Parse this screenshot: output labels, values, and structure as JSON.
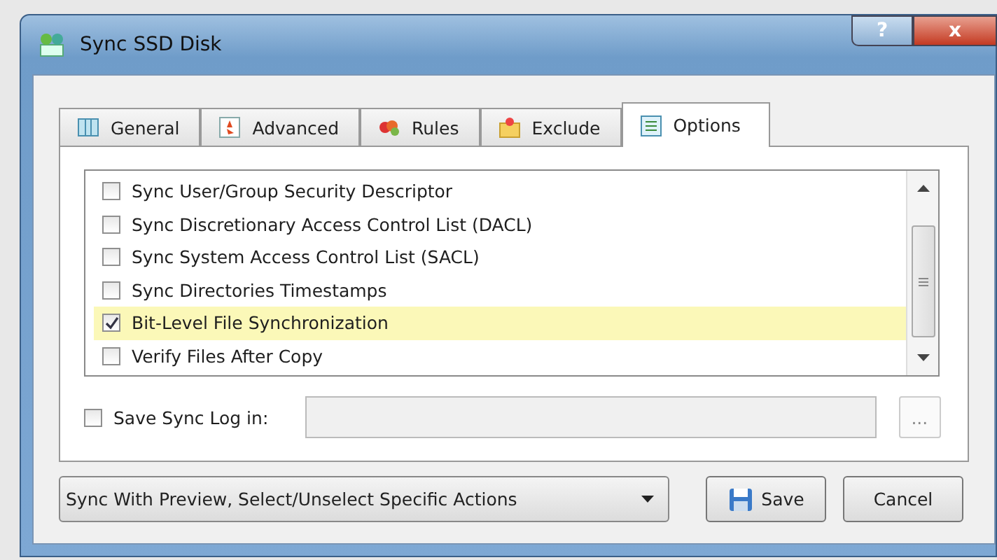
{
  "window": {
    "title": "Sync SSD Disk",
    "buttons": [
      "?",
      "x"
    ]
  },
  "tabs": [
    {
      "label": "General",
      "kind": "columns",
      "selected": false
    },
    {
      "label": "Advanced",
      "kind": "star",
      "selected": false
    },
    {
      "label": "Rules",
      "kind": "hearts",
      "selected": false
    },
    {
      "label": "Exclude",
      "kind": "folder",
      "selected": false
    },
    {
      "label": "Options",
      "kind": "list",
      "selected": true
    }
  ],
  "options": [
    {
      "label": "Sync User/Group Security Descriptor",
      "checked": false,
      "selected": false
    },
    {
      "label": "Sync Discretionary Access Control List (DACL)",
      "checked": false,
      "selected": false
    },
    {
      "label": "Sync System Access Control List (SACL)",
      "checked": false,
      "selected": false
    },
    {
      "label": "Sync Directories Timestamps",
      "checked": false,
      "selected": false
    },
    {
      "label": "Bit-Level File Synchronization",
      "checked": true,
      "selected": true
    },
    {
      "label": "Verify Files After Copy",
      "checked": false,
      "selected": false
    }
  ],
  "log": {
    "label": "Save Sync Log in:",
    "checked": false,
    "browse": "...",
    "disabled": true
  },
  "mode_dropdown": {
    "value": "Sync With Preview, Select/Unselect Specific Actions"
  },
  "buttons": [
    {
      "label": "Save",
      "kind": "save"
    },
    {
      "label": "Cancel",
      "kind": "plain"
    }
  ]
}
